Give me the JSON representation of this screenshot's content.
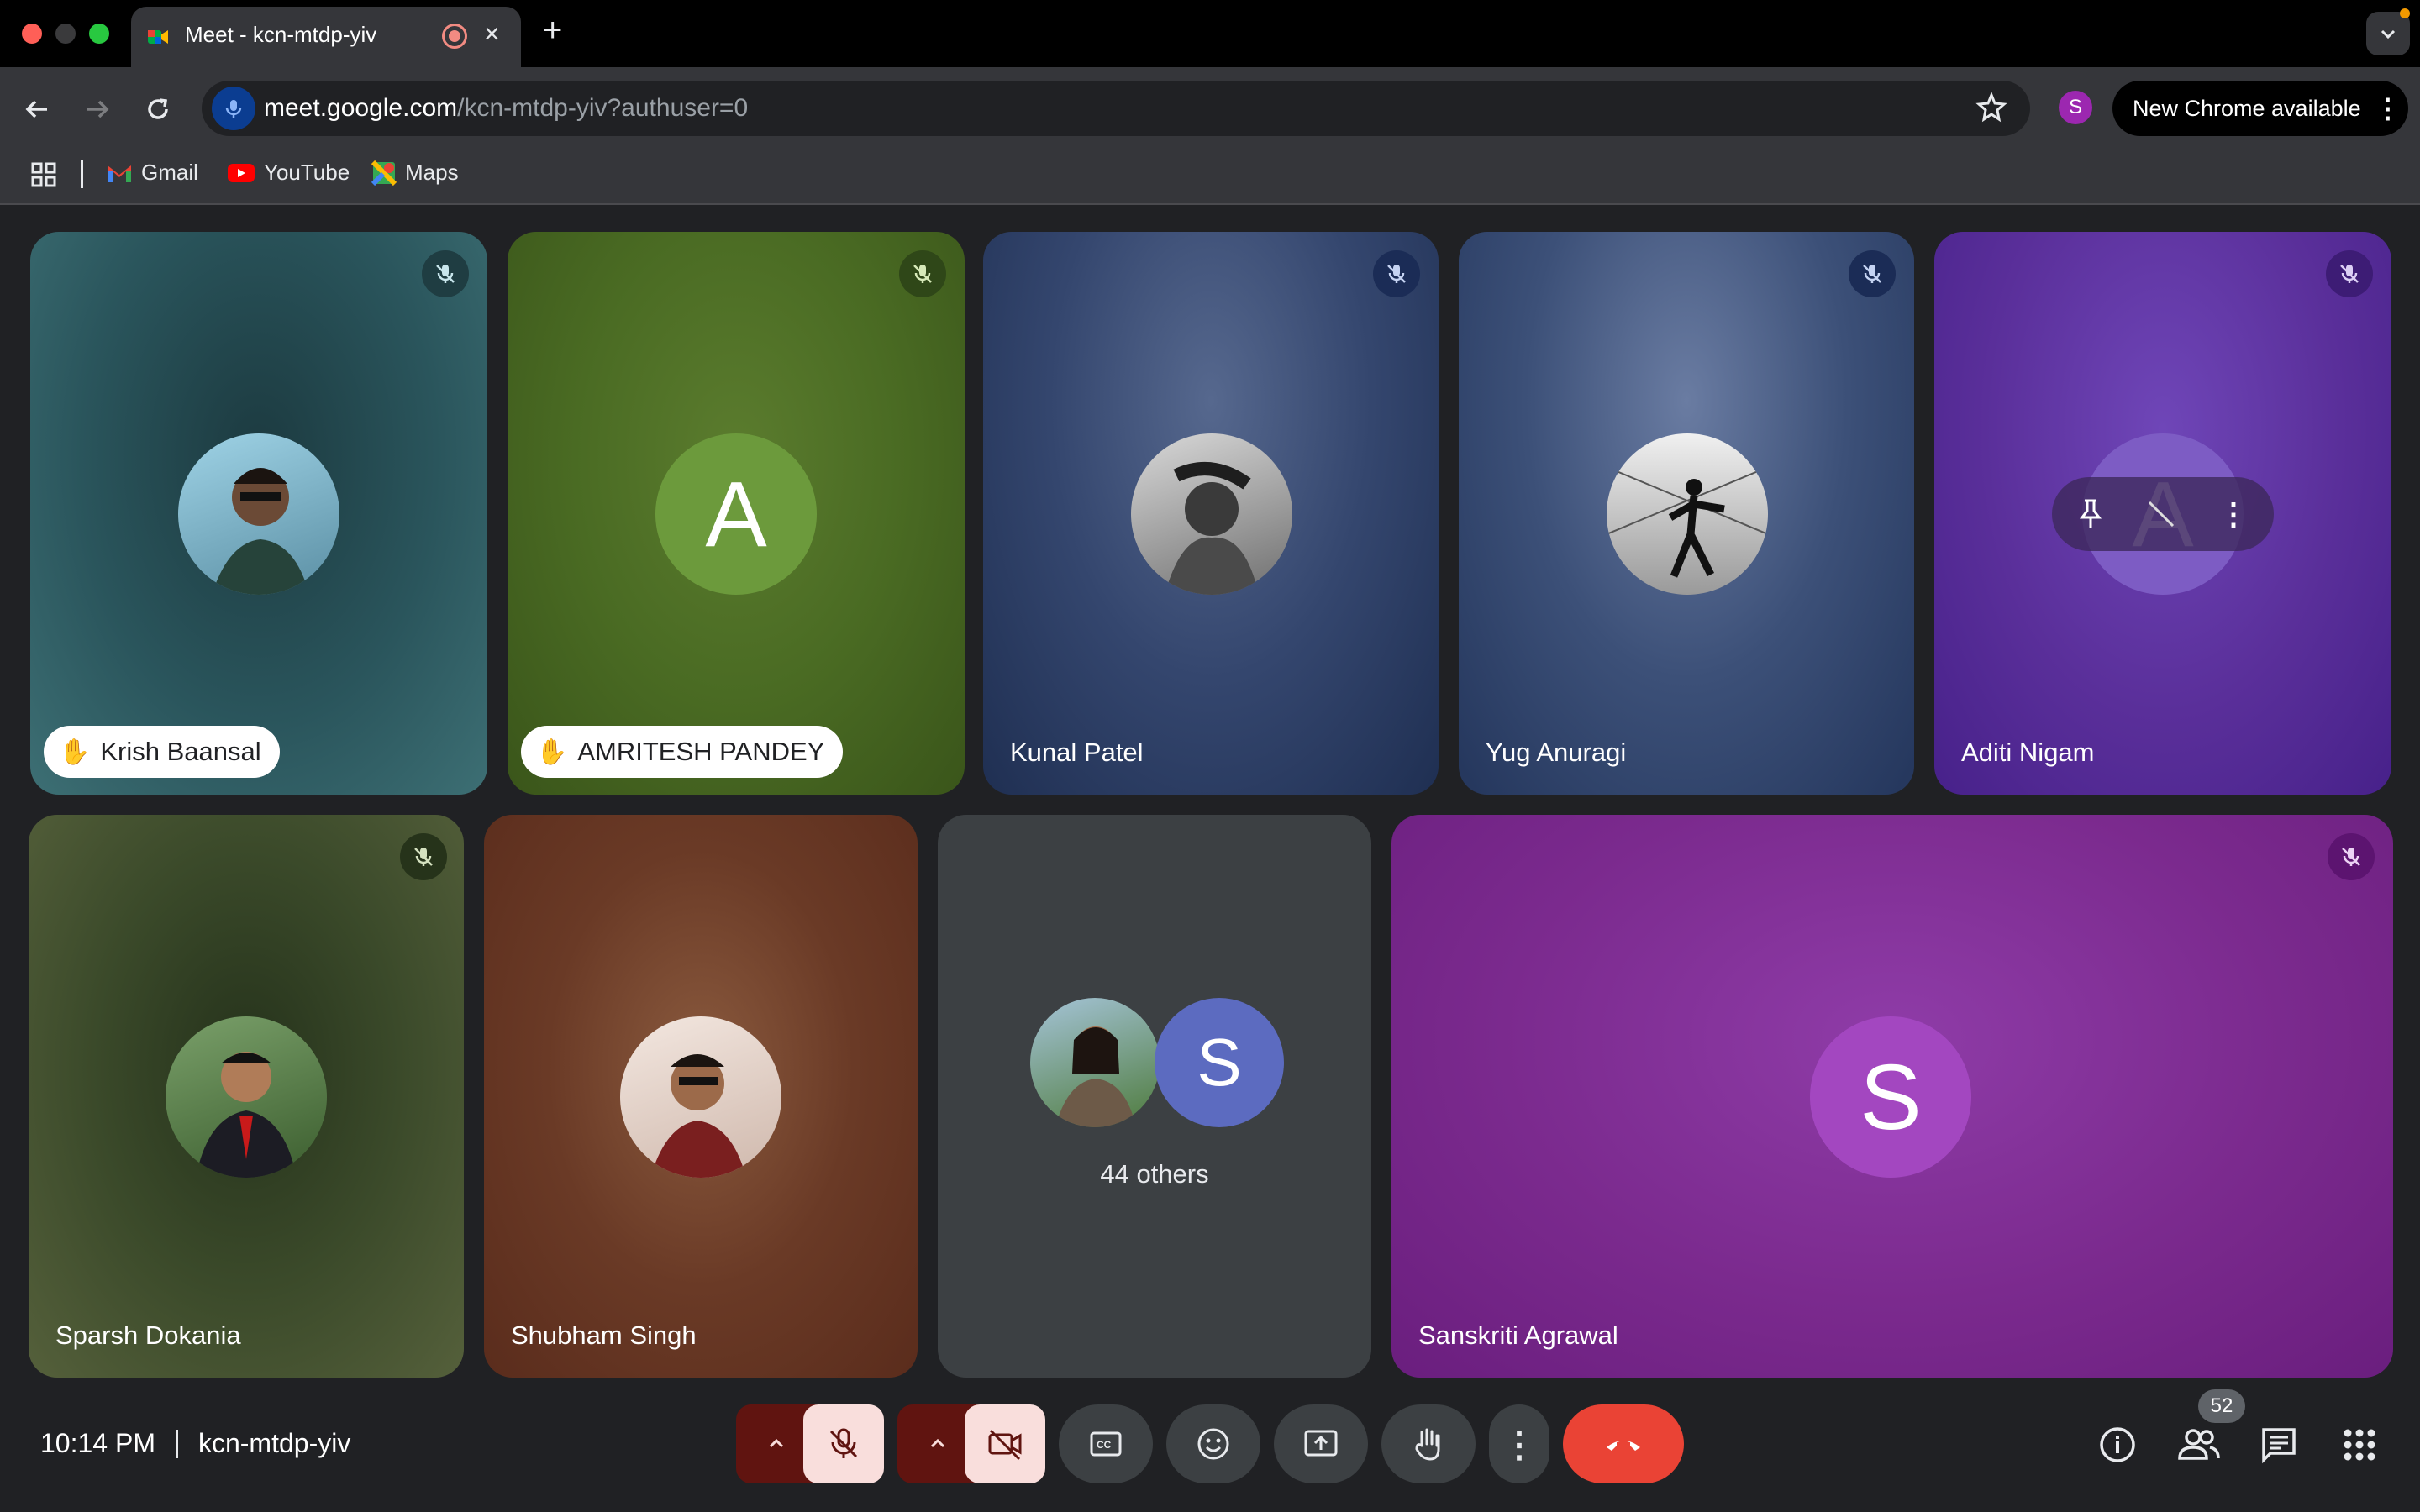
{
  "browser": {
    "tab_title": "Meet - kcn-mtdp-yiv",
    "url_host": "meet.google.com",
    "url_path": "/kcn-mtdp-yiv?authuser=0",
    "profile_initial": "S",
    "update_label": "New Chrome available",
    "bookmarks": [
      "Gmail",
      "YouTube",
      "Maps"
    ]
  },
  "tiles": [
    {
      "name": "Krish Baansal",
      "hand_raised": true,
      "muted": true,
      "color": "#2b4f58"
    },
    {
      "name": "AMRITESH PANDEY",
      "hand_raised": true,
      "muted": true,
      "avatar_letter": "A",
      "color": "#4f6b27"
    },
    {
      "name": "Kunal Patel",
      "muted": true,
      "color": "#2e4063"
    },
    {
      "name": "Yug Anuragi",
      "muted": true,
      "color": "#34476b"
    },
    {
      "name": "Aditi Nigam",
      "muted": true,
      "avatar_letter": "A",
      "color": "#5a2f9a"
    },
    {
      "name": "Sparsh Dokania",
      "muted": true,
      "color": "#3b4a2a"
    },
    {
      "name": "Shubham Singh",
      "color": "#6a3a26"
    },
    {
      "others_label": "44 others",
      "avatar_letter": "S",
      "color": "#3c4043"
    },
    {
      "name": "Sanskriti Agrawal",
      "muted": true,
      "avatar_letter": "S",
      "color": "#7b2a8e"
    }
  ],
  "bottom_bar": {
    "time": "10:14 PM",
    "meeting_code": "kcn-mtdp-yiv",
    "people_count": "52"
  },
  "colors": {
    "end_call": "#ea4335",
    "mic_off_bg": "#f9dedc",
    "accent_dark": "#601410"
  }
}
